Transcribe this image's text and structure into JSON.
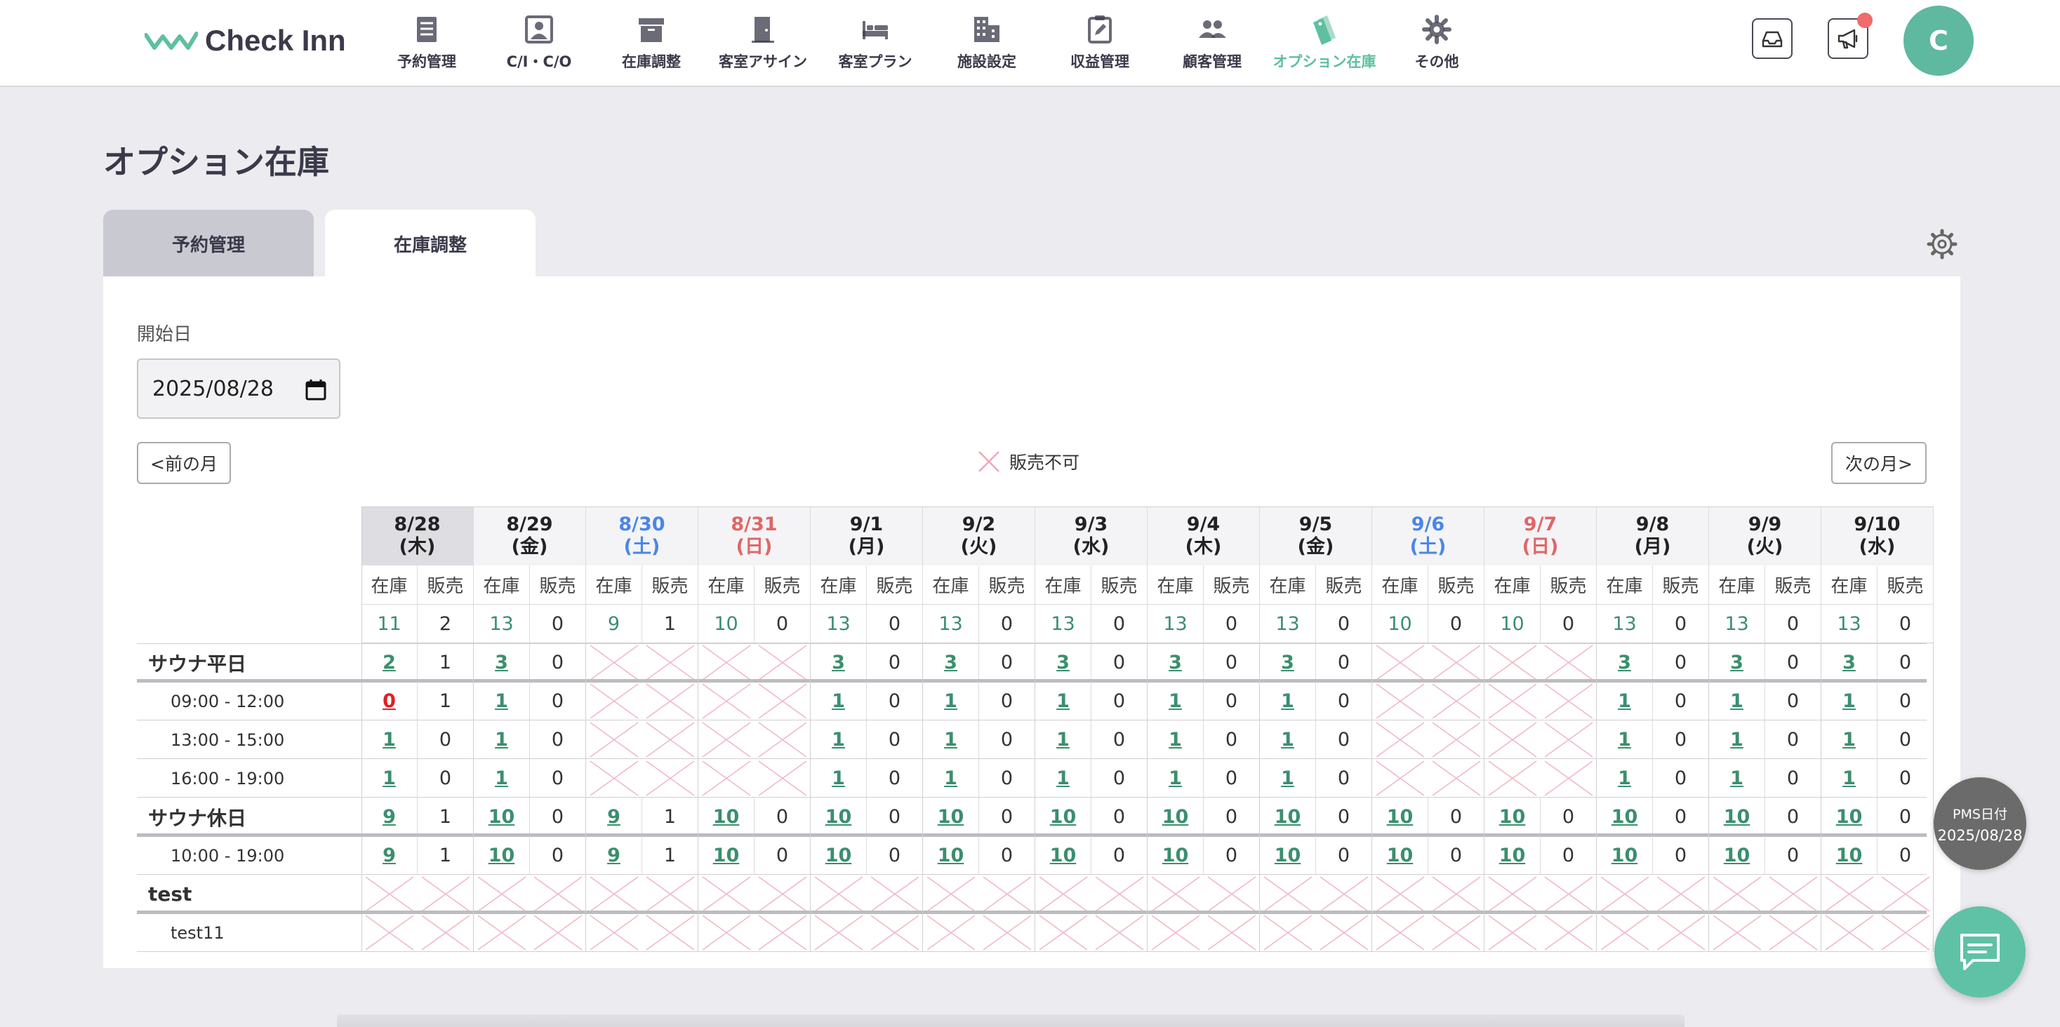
{
  "brand": {
    "name": "Check Inn",
    "accent": "#5ec0a0"
  },
  "nav": [
    {
      "label": "予約管理",
      "icon": "list-icon"
    },
    {
      "label": "C/I・C/O",
      "icon": "id-card-icon"
    },
    {
      "label": "在庫調整",
      "icon": "archive-icon"
    },
    {
      "label": "客室アサイン",
      "icon": "door-icon"
    },
    {
      "label": "客室プラン",
      "icon": "bed-icon"
    },
    {
      "label": "施設設定",
      "icon": "building-icon"
    },
    {
      "label": "収益管理",
      "icon": "clipboard-edit-icon"
    },
    {
      "label": "顧客管理",
      "icon": "people-icon"
    },
    {
      "label": "オプション在庫",
      "icon": "tag-icon",
      "active": true
    },
    {
      "label": "その他",
      "icon": "gear-icon"
    }
  ],
  "user": {
    "initial": "C"
  },
  "page": {
    "title": "オプション在庫"
  },
  "tabs": [
    {
      "label": "予約管理"
    },
    {
      "label": "在庫調整"
    }
  ],
  "form": {
    "start_label": "開始日",
    "start_value": "2025/08/28"
  },
  "buttons": {
    "prev": "<前の月",
    "next": "次の月>"
  },
  "legend": {
    "unavailable": "販売不可"
  },
  "table": {
    "sub_headers": [
      "在庫",
      "販売"
    ],
    "dates": [
      {
        "date": "8/28",
        "dow": "(木)",
        "type": "today"
      },
      {
        "date": "8/29",
        "dow": "(金)",
        "type": "weekday"
      },
      {
        "date": "8/30",
        "dow": "(土)",
        "type": "sat"
      },
      {
        "date": "8/31",
        "dow": "(日)",
        "type": "sun"
      },
      {
        "date": "9/1",
        "dow": "(月)",
        "type": "weekday"
      },
      {
        "date": "9/2",
        "dow": "(火)",
        "type": "weekday"
      },
      {
        "date": "9/3",
        "dow": "(水)",
        "type": "weekday"
      },
      {
        "date": "9/4",
        "dow": "(木)",
        "type": "weekday"
      },
      {
        "date": "9/5",
        "dow": "(金)",
        "type": "weekday"
      },
      {
        "date": "9/6",
        "dow": "(土)",
        "type": "sat"
      },
      {
        "date": "9/7",
        "dow": "(日)",
        "type": "sun"
      },
      {
        "date": "9/8",
        "dow": "(月)",
        "type": "weekday"
      },
      {
        "date": "9/9",
        "dow": "(火)",
        "type": "weekday"
      },
      {
        "date": "9/10",
        "dow": "(水)",
        "type": "weekday"
      }
    ],
    "totals": [
      [
        11,
        2
      ],
      [
        13,
        0
      ],
      [
        9,
        1
      ],
      [
        10,
        0
      ],
      [
        13,
        0
      ],
      [
        13,
        0
      ],
      [
        13,
        0
      ],
      [
        13,
        0
      ],
      [
        13,
        0
      ],
      [
        10,
        0
      ],
      [
        10,
        0
      ],
      [
        13,
        0
      ],
      [
        13,
        0
      ],
      [
        13,
        0
      ]
    ],
    "rows": [
      {
        "label": "サウナ平日",
        "kind": "group",
        "cells": [
          [
            2,
            1
          ],
          [
            3,
            0
          ],
          null,
          null,
          [
            3,
            0
          ],
          [
            3,
            0
          ],
          [
            3,
            0
          ],
          [
            3,
            0
          ],
          [
            3,
            0
          ],
          null,
          null,
          [
            3,
            0
          ],
          [
            3,
            0
          ],
          [
            3,
            0
          ]
        ]
      },
      {
        "label": "09:00 - 12:00",
        "kind": "item",
        "cells": [
          [
            0,
            1
          ],
          [
            1,
            0
          ],
          null,
          null,
          [
            1,
            0
          ],
          [
            1,
            0
          ],
          [
            1,
            0
          ],
          [
            1,
            0
          ],
          [
            1,
            0
          ],
          null,
          null,
          [
            1,
            0
          ],
          [
            1,
            0
          ],
          [
            1,
            0
          ]
        ]
      },
      {
        "label": "13:00 - 15:00",
        "kind": "item",
        "cells": [
          [
            1,
            0
          ],
          [
            1,
            0
          ],
          null,
          null,
          [
            1,
            0
          ],
          [
            1,
            0
          ],
          [
            1,
            0
          ],
          [
            1,
            0
          ],
          [
            1,
            0
          ],
          null,
          null,
          [
            1,
            0
          ],
          [
            1,
            0
          ],
          [
            1,
            0
          ]
        ]
      },
      {
        "label": "16:00 - 19:00",
        "kind": "item",
        "cells": [
          [
            1,
            0
          ],
          [
            1,
            0
          ],
          null,
          null,
          [
            1,
            0
          ],
          [
            1,
            0
          ],
          [
            1,
            0
          ],
          [
            1,
            0
          ],
          [
            1,
            0
          ],
          null,
          null,
          [
            1,
            0
          ],
          [
            1,
            0
          ],
          [
            1,
            0
          ]
        ]
      },
      {
        "label": "サウナ休日",
        "kind": "group",
        "cells": [
          [
            9,
            1
          ],
          [
            10,
            0
          ],
          [
            9,
            1
          ],
          [
            10,
            0
          ],
          [
            10,
            0
          ],
          [
            10,
            0
          ],
          [
            10,
            0
          ],
          [
            10,
            0
          ],
          [
            10,
            0
          ],
          [
            10,
            0
          ],
          [
            10,
            0
          ],
          [
            10,
            0
          ],
          [
            10,
            0
          ],
          [
            10,
            0
          ]
        ]
      },
      {
        "label": "10:00 - 19:00",
        "kind": "item",
        "cells": [
          [
            9,
            1
          ],
          [
            10,
            0
          ],
          [
            9,
            1
          ],
          [
            10,
            0
          ],
          [
            10,
            0
          ],
          [
            10,
            0
          ],
          [
            10,
            0
          ],
          [
            10,
            0
          ],
          [
            10,
            0
          ],
          [
            10,
            0
          ],
          [
            10,
            0
          ],
          [
            10,
            0
          ],
          [
            10,
            0
          ],
          [
            10,
            0
          ]
        ]
      },
      {
        "label": "test",
        "kind": "group",
        "cells": [
          null,
          null,
          null,
          null,
          null,
          null,
          null,
          null,
          null,
          null,
          null,
          null,
          null,
          null
        ]
      },
      {
        "label": "test11",
        "kind": "item",
        "cells": [
          null,
          null,
          null,
          null,
          null,
          null,
          null,
          null,
          null,
          null,
          null,
          null,
          null,
          null
        ]
      }
    ]
  },
  "pms": {
    "label": "PMS日付",
    "value": "2025/08/28"
  },
  "colors": {
    "sat": "#4a86e8",
    "sun": "#e06666",
    "inv": "#3b8f6e",
    "zero": "#e02020",
    "cross": "#f2b8c6"
  }
}
